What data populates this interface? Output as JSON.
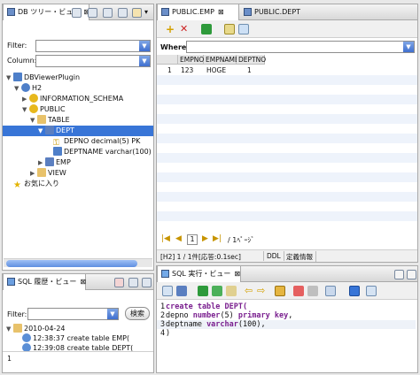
{
  "left_top": {
    "tab_label": "DB ツリー・ビュー",
    "filter_label": "Filter:",
    "column_label": "Column:",
    "tree": [
      {
        "text": "DBViewerPlugin",
        "depth": 0
      },
      {
        "text": "H2",
        "depth": 1
      },
      {
        "text": "INFORMATION_SCHEMA",
        "depth": 2
      },
      {
        "text": "PUBLIC",
        "depth": 2
      },
      {
        "text": "TABLE",
        "depth": 3
      },
      {
        "text": "DEPT",
        "depth": 4
      },
      {
        "text": "DEPNO decimal(5) PK",
        "depth": 5
      },
      {
        "text": "DEPTNAME varchar(100)",
        "depth": 5
      },
      {
        "text": "EMP",
        "depth": 4
      },
      {
        "text": "VIEW",
        "depth": 3
      },
      {
        "text": "お気に入り",
        "depth": 0
      }
    ]
  },
  "left_bottom": {
    "tab_label": "SQL 履歴・ビュー",
    "filter_label": "Filter:",
    "search_button": "検索",
    "history": [
      {
        "text": "2010-04-24"
      },
      {
        "text": "12:38:37 create table EMP("
      },
      {
        "text": "12:39:08 create table DEPT("
      }
    ],
    "preview": "1"
  },
  "right_top": {
    "tabs": [
      "PUBLIC.EMP",
      "PUBLIC.DEPT"
    ],
    "where_label": "Where:",
    "columns": [
      "EMPNO",
      "EMPNAME",
      "DEPTNO"
    ],
    "rows": [
      {
        "num": "1",
        "cells": [
          "123",
          "HOGE",
          "1"
        ]
      }
    ],
    "pager_page": "1",
    "pager_total": "/ 1ﾍﾟｰｼﾞ",
    "status": [
      "[H2] 1 / 1件[応答:0.1sec]",
      "DDL",
      "定義情報"
    ]
  },
  "right_bottom": {
    "tab_label": "SQL 実行・ビュー",
    "lines": [
      {
        "num": "1",
        "parts": [
          {
            "t": "create table DEPT(",
            "k": "kw"
          }
        ]
      },
      {
        "num": "2",
        "parts": [
          {
            "t": "depno ",
            "k": ""
          },
          {
            "t": "number",
            "k": "ty"
          },
          {
            "t": "(5) ",
            "k": ""
          },
          {
            "t": "primary key",
            "k": "kw"
          },
          {
            "t": ",",
            "k": ""
          }
        ]
      },
      {
        "num": "3",
        "parts": [
          {
            "t": "deptname ",
            "k": ""
          },
          {
            "t": "varchar",
            "k": "ty"
          },
          {
            "t": "(100),",
            "k": ""
          }
        ]
      },
      {
        "num": "4",
        "parts": [
          {
            "t": ")",
            "k": ""
          }
        ]
      }
    ]
  },
  "colors": {
    "selection": "#3875d7",
    "accent": "#5f8fe0",
    "keyword": "#7a1f8f"
  }
}
